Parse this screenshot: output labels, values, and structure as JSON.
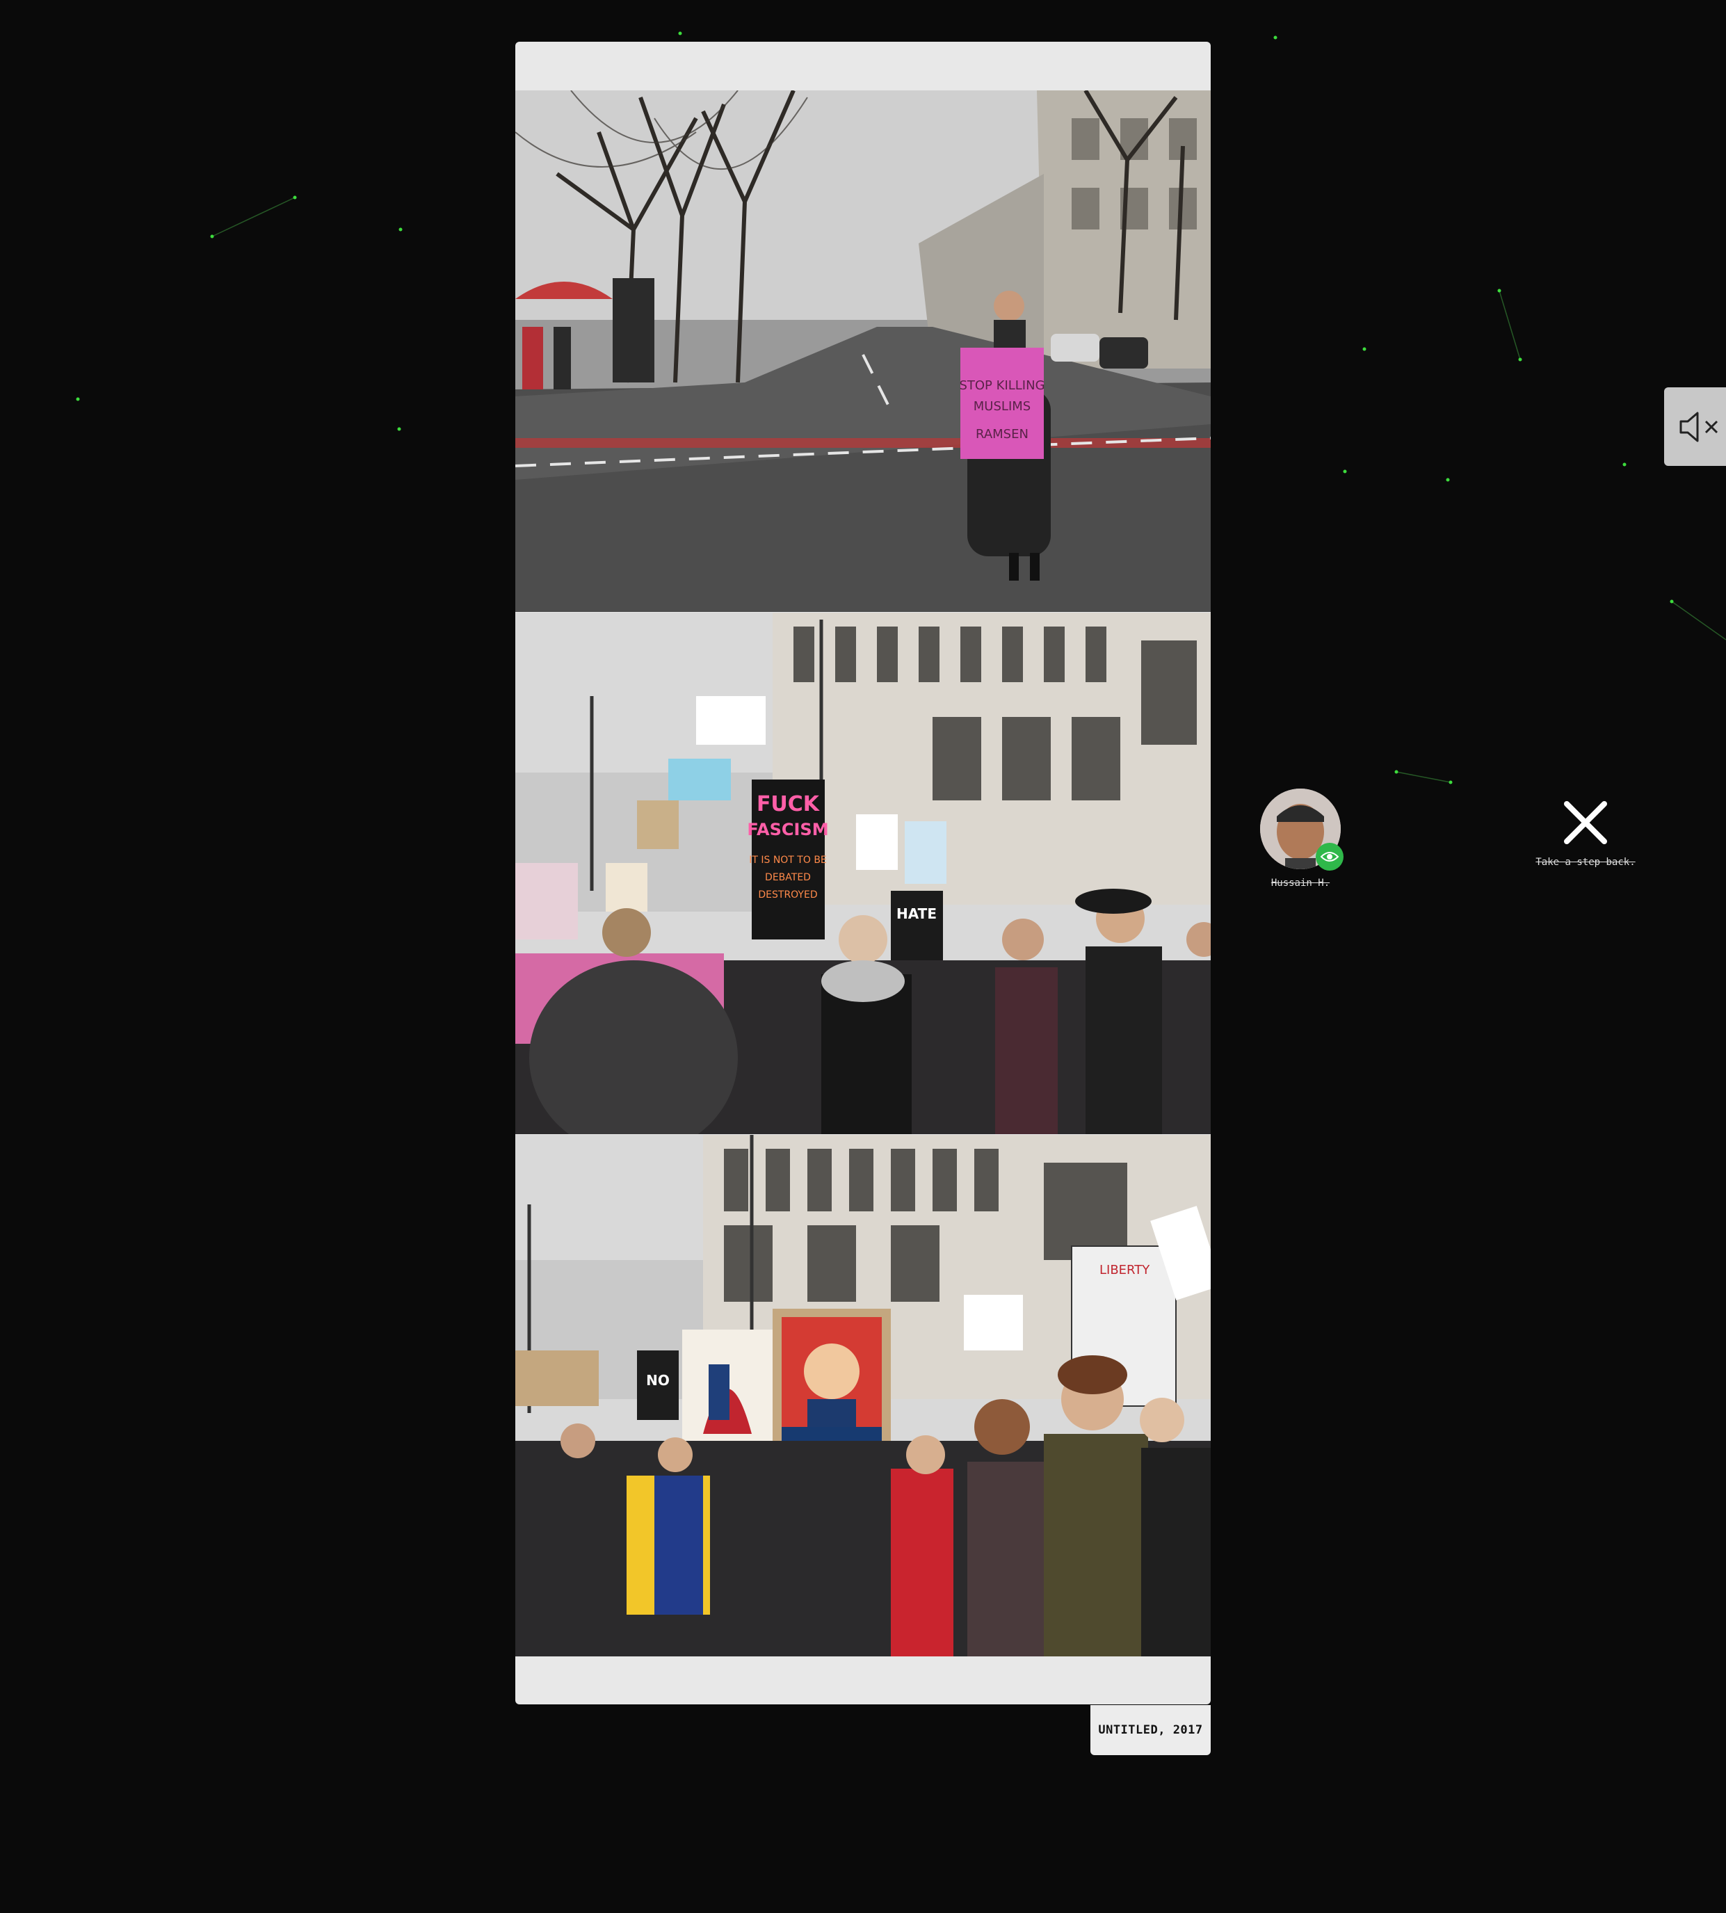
{
  "gallery": {
    "caption": "UNTITLED, 2017",
    "photos": [
      {
        "name": "street-protest-photo",
        "sign_text": "STOP KILLING MUSLIMS RAMSEN"
      },
      {
        "name": "crowd-protest-photo",
        "sign_text": "FUCK FASCISM"
      },
      {
        "name": "nope-protest-photo",
        "sign_text": "NOPE"
      }
    ]
  },
  "controls": {
    "mute_icon": "speaker-muted-icon",
    "close_icon": "close-icon",
    "close_label": "Take a step back."
  },
  "user": {
    "name": "Hussain H.",
    "badge_icon": "eye-icon",
    "badge_color": "#2fb84a"
  },
  "colors": {
    "background": "#0a0a0a",
    "card": "#e8e8e8",
    "star": "#3ddc3d"
  }
}
